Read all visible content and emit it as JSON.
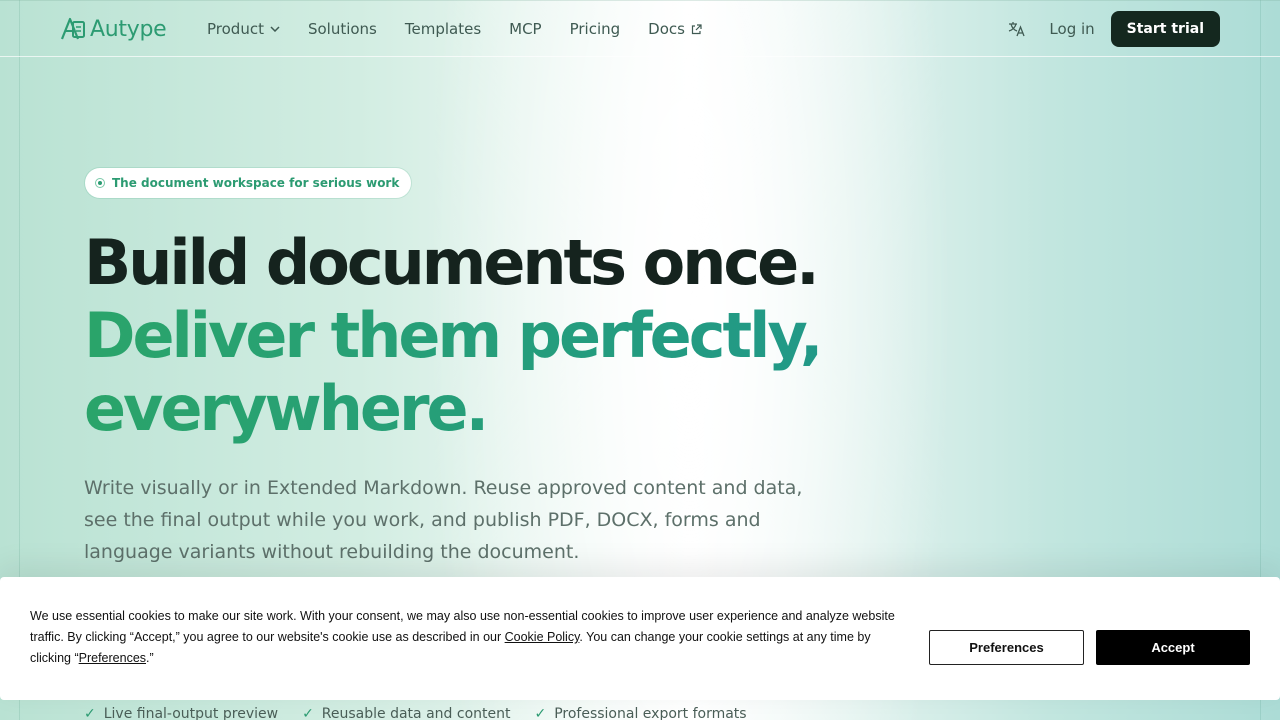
{
  "nav": {
    "logo_text": "Autype",
    "menu": [
      {
        "label": "Product",
        "icon": "chevron-down-icon"
      },
      {
        "label": "Solutions"
      },
      {
        "label": "Templates"
      },
      {
        "label": "MCP"
      },
      {
        "label": "Pricing"
      },
      {
        "label": "Docs",
        "icon": "external-link-icon"
      }
    ],
    "language_icon": "translate-icon",
    "login_label": "Log in",
    "cta_label": "Start trial"
  },
  "hero": {
    "badge": "The document workspace for serious work",
    "headline_line1": "Build documents once.",
    "headline_line2": "Deliver them perfectly,",
    "headline_line3": "everywhere.",
    "subtitle": "Write visually or in Extended Markdown. Reuse approved content and data, see the final output while you work, and publish PDF, DOCX, forms and language variants without rebuilding the document.",
    "features": [
      "Live final-output preview",
      "Reusable data and content",
      "Professional export formats"
    ]
  },
  "cookie_banner": {
    "text_part1": "We use essential cookies to make our site work. With your consent, we may also use non-essential cookies to improve user experience and analyze website traffic. By clicking “Accept,” you agree to our website's cookie use as described in our ",
    "policy_link": "Cookie Policy",
    "text_part2": ". You can change your cookie settings at any time by clicking “",
    "preferences_link": "Preferences",
    "text_part3": ".”",
    "preferences_button": "Preferences",
    "accept_button": "Accept"
  },
  "colors": {
    "brand_green": "#2c9b72",
    "dark": "#14281f",
    "headline_gradient_start": "#2aa46a",
    "headline_gradient_end": "#21988a"
  }
}
